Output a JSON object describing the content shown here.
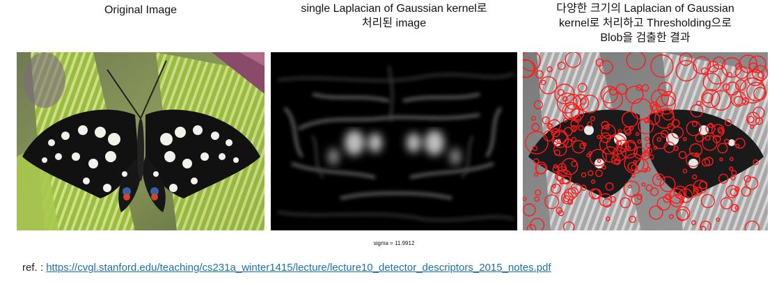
{
  "captions": {
    "original": "Original Image",
    "log_single": "single Laplacian of Gaussian kernel로\n처리된 image",
    "blob_result": "다양한 크기의 Laplacian of Gaussian\nkernel로 처리하고  Thresholding으로\nBlob을 검출한 결과"
  },
  "sigma_label": "sigma = 11.9912",
  "reference": {
    "prefix": "ref. : ",
    "link_text": "https://cvgl.stanford.edu/teaching/cs231a_winter1415/lecture/lecture10_detector_descriptors_2015_notes.pdf"
  },
  "colors": {
    "blob_circle": "#ff1a1a",
    "leaf_green": "#8fb83a",
    "link": "#1a73a8"
  }
}
